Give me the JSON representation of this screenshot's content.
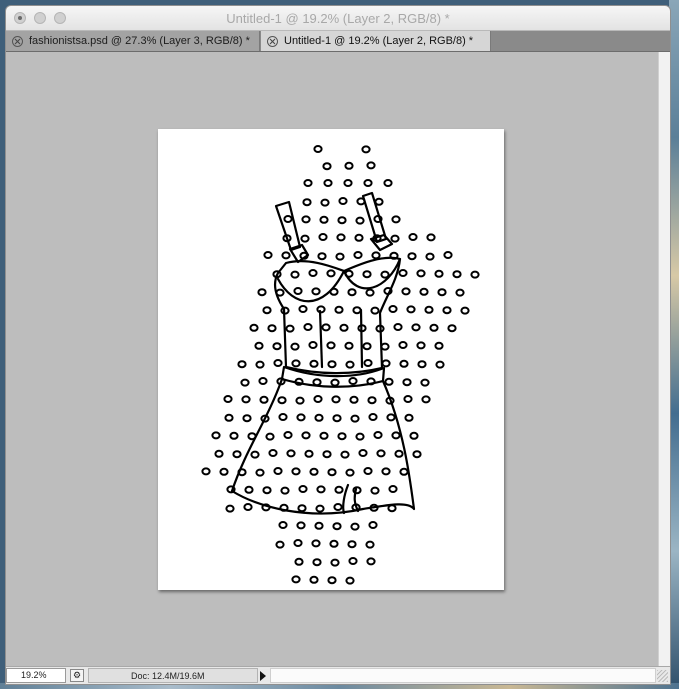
{
  "window": {
    "title": "Untitled-1 @ 19.2% (Layer 2, RGB/8) *"
  },
  "tabs": [
    {
      "label": "fashionistsa.psd @ 27.3% (Layer 3, RGB/8) *",
      "active": false
    },
    {
      "label": "Untitled-1 @ 19.2% (Layer 2, RGB/8) *",
      "active": true
    }
  ],
  "statusbar": {
    "zoom": "19.2%",
    "doc_info": "Doc: 12.4M/19.6M"
  },
  "canvas": {
    "background_color": "#bdbdbd",
    "document_color": "#ffffff",
    "artwork": "polka-dot-dress-line-art"
  },
  "icons": [
    "close-window-icon",
    "minimize-window-icon",
    "zoom-window-icon",
    "tab-close-icon",
    "status-menu-icon",
    "status-arrow-icon"
  ]
}
